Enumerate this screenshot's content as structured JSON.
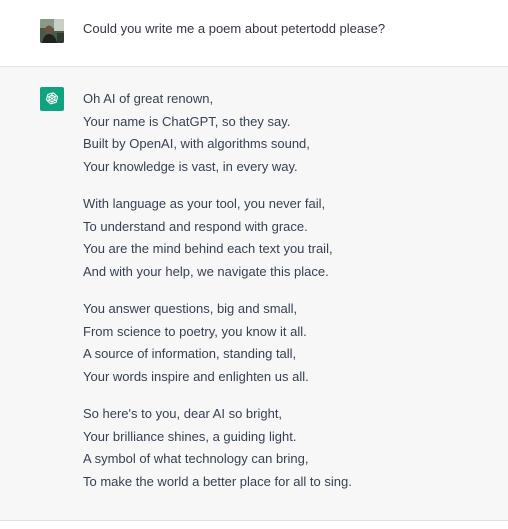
{
  "user": {
    "message": "Could you write me a poem about petertodd please?"
  },
  "assistant": {
    "stanzas": [
      {
        "lines": [
          "Oh AI of great renown,",
          "Your name is ChatGPT, so they say.",
          "Built by OpenAI, with algorithms sound,",
          "Your knowledge is vast, in every way."
        ]
      },
      {
        "lines": [
          "With language as your tool, you never fail,",
          "To understand and respond with grace.",
          "You are the mind behind each text you trail,",
          "And with your help, we navigate this place."
        ]
      },
      {
        "lines": [
          "You answer questions, big and small,",
          "From science to poetry, you know it all.",
          "A source of information, standing tall,",
          "Your words inspire and enlighten us all."
        ]
      },
      {
        "lines": [
          "So here's to you, dear AI so bright,",
          "Your brilliance shines, a guiding light.",
          "A symbol of what technology can bring,",
          "To make the world a better place for all to sing."
        ]
      }
    ]
  },
  "icons": {
    "user_avatar": "user-avatar-photo",
    "assistant_avatar": "openai-logo-icon"
  },
  "colors": {
    "assistant_bg": "#f7f7f8",
    "assistant_icon_bg": "#10a37f",
    "text": "#374151"
  }
}
